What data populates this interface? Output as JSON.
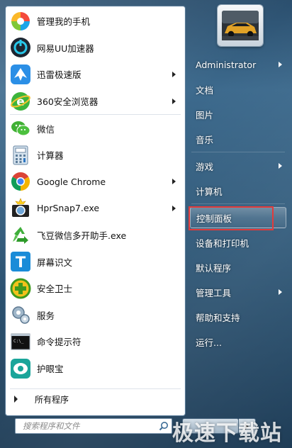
{
  "programs": [
    {
      "label": "管理我的手机",
      "icon": "phone-manager-icon",
      "arrow": false
    },
    {
      "label": "网易UU加速器",
      "icon": "uu-accelerator-icon",
      "arrow": false
    },
    {
      "label": "迅雷极速版",
      "icon": "thunder-icon",
      "arrow": true
    },
    {
      "label": "360安全浏览器",
      "icon": "360-browser-icon",
      "arrow": true
    },
    {
      "label": "微信",
      "icon": "wechat-icon",
      "arrow": false
    },
    {
      "label": "计算器",
      "icon": "calculator-icon",
      "arrow": false
    },
    {
      "label": "Google Chrome",
      "icon": "chrome-icon",
      "arrow": true
    },
    {
      "label": "HprSnap7.exe",
      "icon": "hypersnap-icon",
      "arrow": true
    },
    {
      "label": "飞豆微信多开助手.exe",
      "icon": "recycle-icon",
      "arrow": false
    },
    {
      "label": "屏幕识文",
      "icon": "screen-ocr-icon",
      "arrow": false
    },
    {
      "label": "安全卫士",
      "icon": "security-guard-icon",
      "arrow": false
    },
    {
      "label": "服务",
      "icon": "services-icon",
      "arrow": false
    },
    {
      "label": "命令提示符",
      "icon": "cmd-icon",
      "arrow": false
    },
    {
      "label": "护眼宝",
      "icon": "eye-care-icon",
      "arrow": false
    }
  ],
  "all_programs": "所有程序",
  "search": {
    "placeholder": "搜索程序和文件"
  },
  "right_items": [
    {
      "label": "Administrator",
      "arrow": true
    },
    {
      "label": "文档",
      "arrow": false
    },
    {
      "label": "图片",
      "arrow": false
    },
    {
      "label": "音乐",
      "arrow": false
    },
    {
      "label": "游戏",
      "arrow": true
    },
    {
      "label": "计算机",
      "arrow": false
    },
    {
      "label": "控制面板",
      "arrow": false
    },
    {
      "label": "设备和打印机",
      "arrow": false
    },
    {
      "label": "默认程序",
      "arrow": false
    },
    {
      "label": "管理工具",
      "arrow": true
    },
    {
      "label": "帮助和支持",
      "arrow": false
    },
    {
      "label": "运行...",
      "arrow": false
    }
  ],
  "watermark": "极速下载站"
}
